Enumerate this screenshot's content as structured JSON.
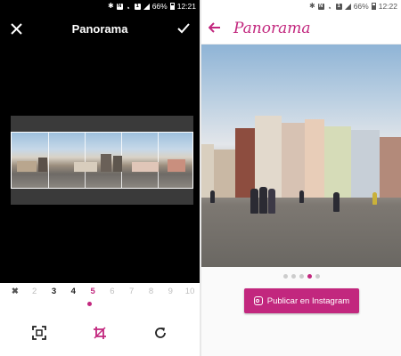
{
  "left": {
    "status": {
      "battery": "66%",
      "time": "12:21"
    },
    "header": {
      "title": "Panorama"
    },
    "slider": {
      "numbers": [
        "2",
        "3",
        "4",
        "5",
        "6",
        "7",
        "8",
        "9",
        "10"
      ],
      "selected": "5"
    }
  },
  "right": {
    "status": {
      "battery": "66%",
      "time": "12:22"
    },
    "header": {
      "title": "Panorama"
    },
    "pager": {
      "count": 5,
      "active_index": 3
    },
    "share_button": {
      "label": "Publicar en Instagram"
    }
  },
  "colors": {
    "accent": "#c2277e",
    "dark_bg": "#000000",
    "light_bg": "#fafafa"
  },
  "icons": [
    "close-icon",
    "check-icon",
    "back-arrow-icon",
    "crop-fit-icon",
    "crop-icon",
    "rotate-icon",
    "instagram-icon"
  ]
}
